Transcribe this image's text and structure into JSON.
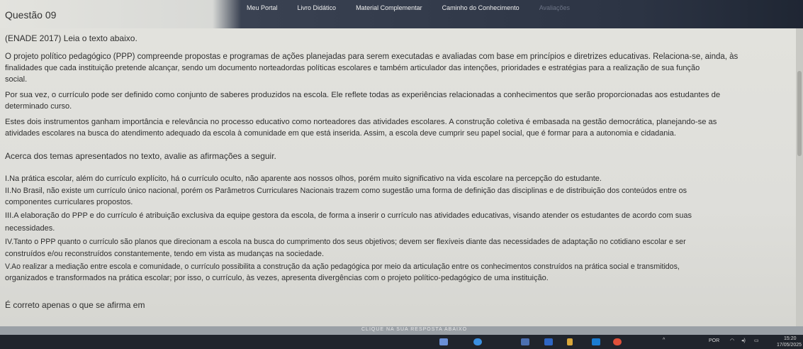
{
  "nav": {
    "items": [
      "Meu Portal",
      "Livro Didático",
      "Material Complementar",
      "Caminho do Conhecimento",
      "Avaliações"
    ]
  },
  "question": {
    "title": "Questão 09",
    "source": "(ENADE 2017) Leia o texto abaixo.",
    "text_lines": [
      "O projeto político pedagógico (PPP) compreende propostas e programas de ações planejadas para serem executadas e avaliadas com base em princípios e diretrizes educativas. Relaciona-se, ainda, às",
      "finalidades que cada instituição pretende alcançar, sendo um documento norteadordas políticas escolares e também articulador das intenções, prioridades e estratégias para a realização de sua função",
      "social.",
      "Por sua vez, o currículo pode ser definido como conjunto de saberes produzidos na escola. Ele reflete todas as experiências relacionadas a conhecimentos que serão proporcionadas aos estudantes de",
      "determinado curso.",
      "Estes dois instrumentos ganham importância e relevância no processo educativo como norteadores das atividades escolares. A construção coletiva é embasada na gestão democrática, planejando-se as",
      "atividades escolares na busca do atendimento adequado da escola à comunidade em que está inserida. Assim, a escola deve cumprir seu papel social, que é formar para a autonomia e cidadania."
    ],
    "prompt": "Acerca dos temas apresentados no texto, avalie as afirmações a seguir.",
    "statement_lines": [
      "I.Na prática escolar, além do currículo explícito, há o currículo oculto, não aparente aos nossos olhos, porém muito significativo na vida escolare na percepção do estudante.",
      "II.No Brasil, não existe um currículo único nacional, porém os Parâmetros Curriculares Nacionais trazem como sugestão uma forma de definição das disciplinas e de distribuição dos conteúdos entre os",
      "componentes curriculares propostos.",
      "III.A elaboração do PPP e do currículo é atribuição exclusiva da equipe gestora da escola, de forma a inserir o currículo nas atividades educativas, visando atender os estudantes de acordo com suas",
      "necessidades.",
      "IV.Tanto o PPP quanto o currículo são planos que direcionam a escola na busca do cumprimento dos seus objetivos; devem ser flexíveis diante das necessidades de adaptação no cotidiano escolar e ser",
      "construídos e/ou reconstruídos constantemente, tendo em vista as mudanças na sociedade.",
      "V.Ao realizar a mediação entre escola e comunidade, o currículo possibilita a construção da ação pedagógica por meio da articulação entre os conhecimentos construídos na prática social e transmitidos,",
      "organizados e transformados na prática escolar; por isso, o currículo, às vezes, apresenta divergências com o projeto político-pedagógico de uma instituição."
    ],
    "closing": "É correto apenas o que se afirma em"
  },
  "answer_bar": {
    "label": "CLIQUE NA SUA RESPOSTA ABAIXO"
  },
  "taskbar": {
    "lang": "POR",
    "time": "15:20",
    "date": "17/05/2025"
  },
  "colors": {
    "nav_bg": "#2c3444",
    "content_bg": "#e0e0db",
    "taskbar_bg": "#20242c"
  }
}
